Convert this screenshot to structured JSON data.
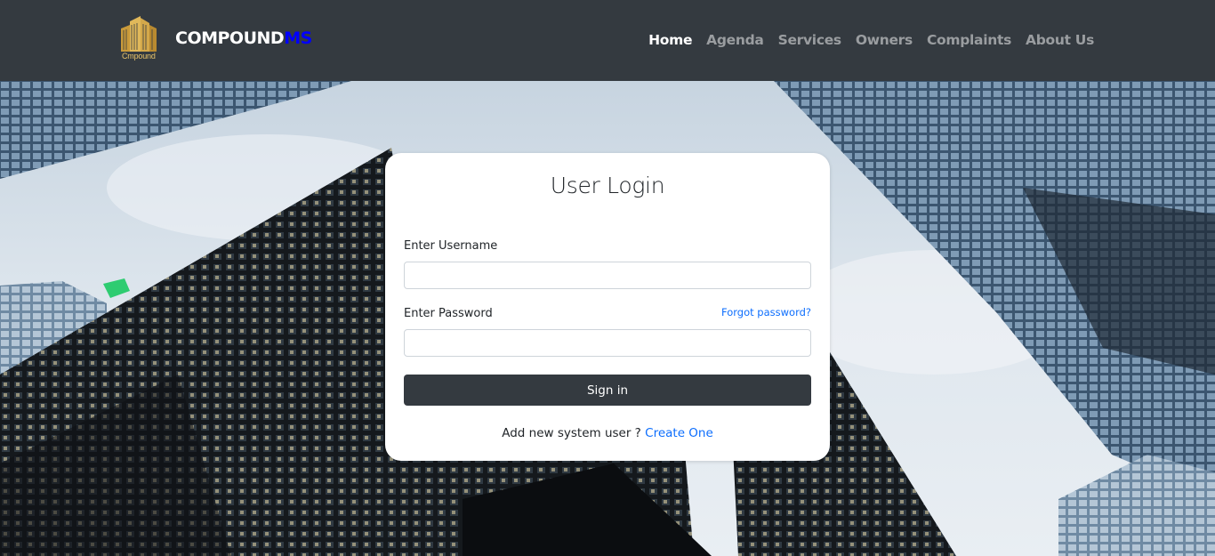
{
  "navbar": {
    "logo_caption": "Cmpound",
    "brand_main": "COMPOUND",
    "brand_accent": "MS",
    "links": [
      {
        "label": "Home",
        "active": true
      },
      {
        "label": "Agenda",
        "active": false
      },
      {
        "label": "Services",
        "active": false
      },
      {
        "label": "Owners",
        "active": false
      },
      {
        "label": "Complaints",
        "active": false
      },
      {
        "label": "About Us",
        "active": false
      }
    ]
  },
  "login": {
    "title": "User Login",
    "username_label": "Enter Username",
    "username_value": "",
    "password_label": "Enter Password",
    "password_value": "",
    "forgot_link": "Forgot password?",
    "signin_label": "Sign in",
    "footer_text": "Add new system user ?",
    "create_link": "Create One"
  },
  "colors": {
    "navbar_bg": "#343a40",
    "brand_accent": "#0000ff",
    "link": "#0d6efd",
    "button_bg": "#343a40"
  },
  "icons": {
    "logo": "building-logo-icon"
  }
}
